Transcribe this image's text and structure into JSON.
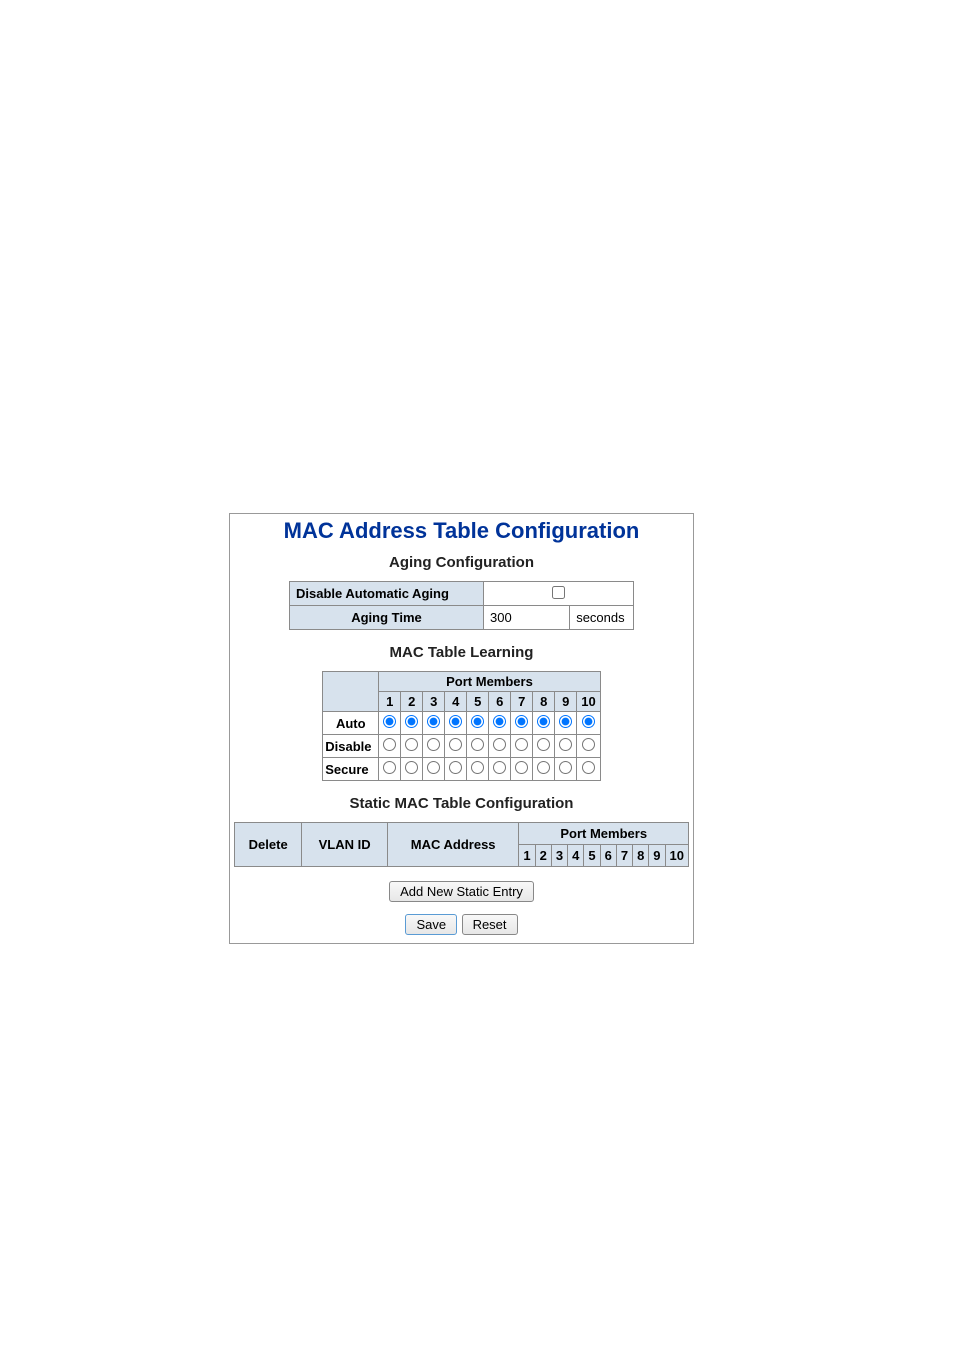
{
  "titles": {
    "main": "MAC Address Table Configuration",
    "aging": "Aging Configuration",
    "learning": "MAC Table Learning",
    "static": "Static MAC Table Configuration"
  },
  "aging": {
    "disable_label": "Disable Automatic Aging",
    "disable_checked": false,
    "time_label": "Aging Time",
    "time_value": "300",
    "time_unit": "seconds"
  },
  "learning": {
    "port_members_label": "Port Members",
    "ports": [
      "1",
      "2",
      "3",
      "4",
      "5",
      "6",
      "7",
      "8",
      "9",
      "10"
    ],
    "rows": [
      {
        "label": "Auto",
        "selected": [
          true,
          true,
          true,
          true,
          true,
          true,
          true,
          true,
          true,
          true
        ]
      },
      {
        "label": "Disable",
        "selected": [
          false,
          false,
          false,
          false,
          false,
          false,
          false,
          false,
          false,
          false
        ]
      },
      {
        "label": "Secure",
        "selected": [
          false,
          false,
          false,
          false,
          false,
          false,
          false,
          false,
          false,
          false
        ]
      }
    ]
  },
  "static_table": {
    "port_members_label": "Port Members",
    "headers": [
      "Delete",
      "VLAN ID",
      "MAC Address"
    ],
    "ports": [
      "1",
      "2",
      "3",
      "4",
      "5",
      "6",
      "7",
      "8",
      "9",
      "10"
    ],
    "rows": []
  },
  "buttons": {
    "add": "Add New Static Entry",
    "save": "Save",
    "reset": "Reset"
  }
}
